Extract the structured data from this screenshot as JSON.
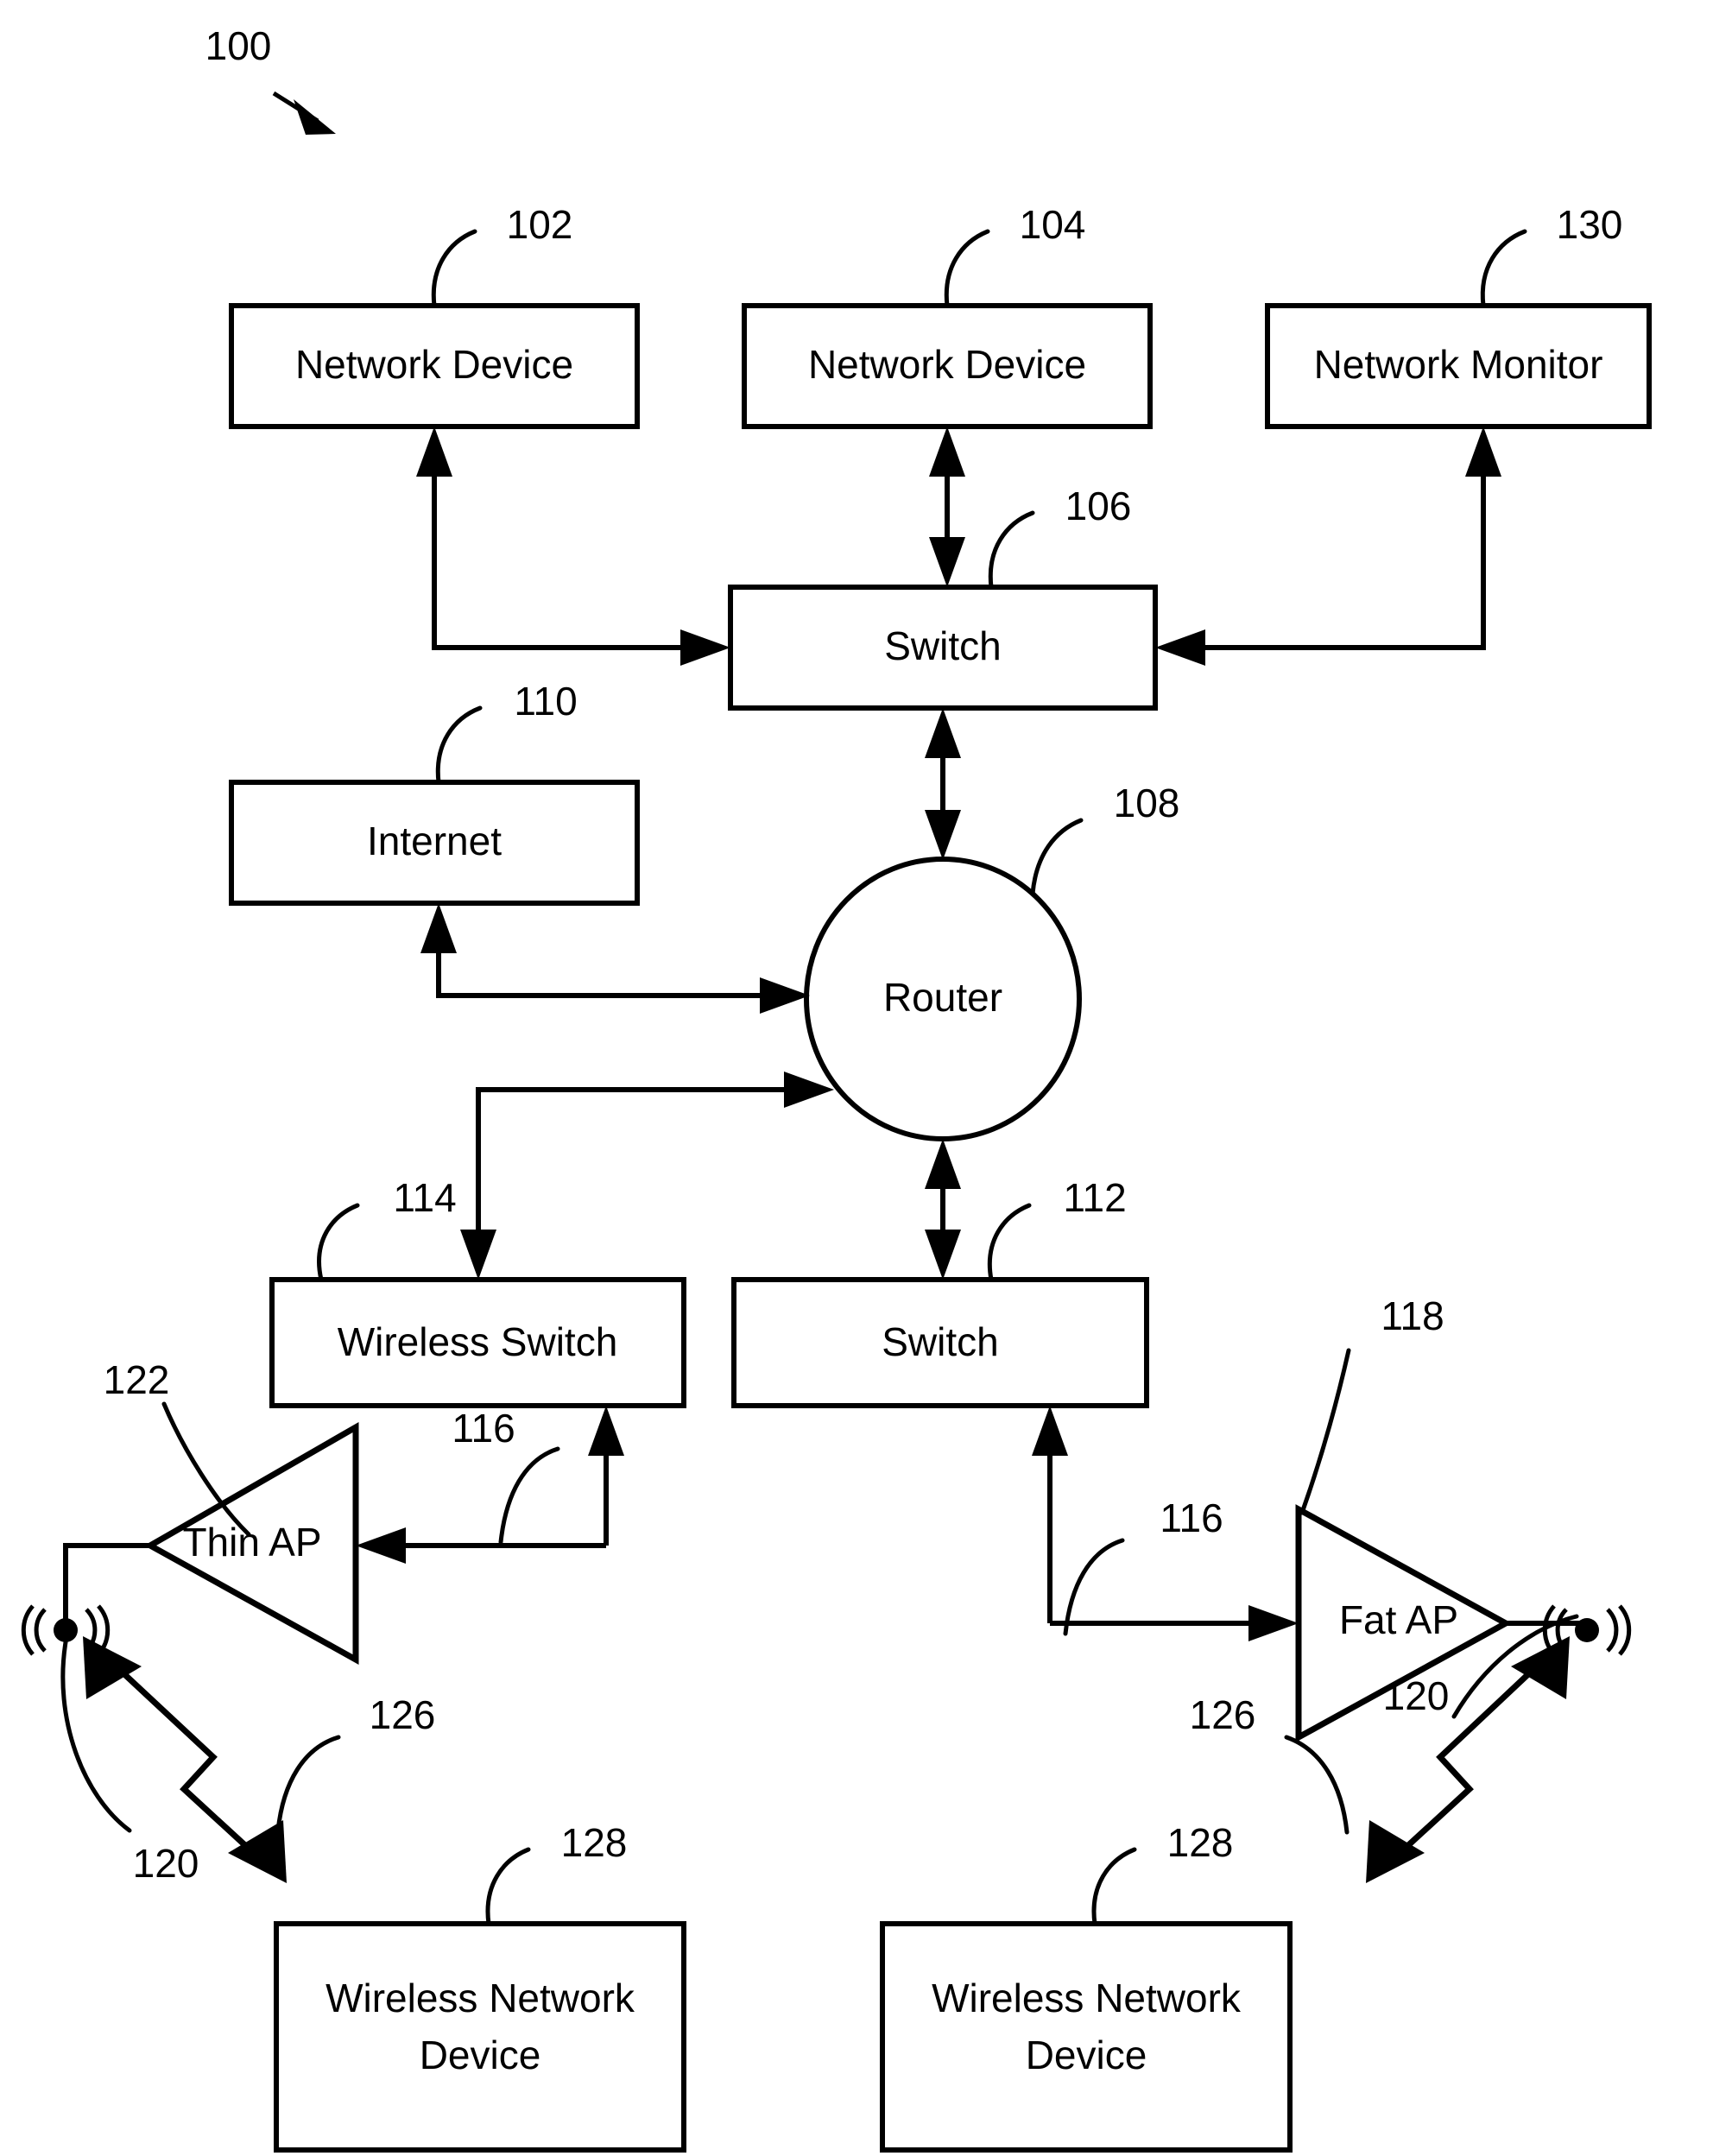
{
  "figure": {
    "reference_number": "100",
    "nodes": {
      "network_device_102": {
        "label": "Network Device",
        "ref": "102"
      },
      "network_device_104": {
        "label": "Network Device",
        "ref": "104"
      },
      "network_monitor_130": {
        "label": "Network Monitor",
        "ref": "130"
      },
      "switch_106": {
        "label": "Switch",
        "ref": "106"
      },
      "internet_110": {
        "label": "Internet",
        "ref": "110"
      },
      "router_108": {
        "label": "Router",
        "ref": "108"
      },
      "wireless_switch_114": {
        "label": "Wireless Switch",
        "ref": "114"
      },
      "switch_112": {
        "label": "Switch",
        "ref": "112"
      },
      "thin_ap_122": {
        "label": "Thin AP",
        "ref": "122"
      },
      "fat_ap_118": {
        "label": "Fat AP",
        "ref": "118"
      },
      "wireless_network_device_left": {
        "label_line1": "Wireless Network",
        "label_line2": "Device",
        "ref": "128"
      },
      "wireless_network_device_right": {
        "label_line1": "Wireless Network",
        "label_line2": "Device",
        "ref": "128"
      }
    },
    "link_refs": {
      "wired_link_left_116": "116",
      "wired_link_right_116": "116",
      "antenna_left_120": "120",
      "antenna_right_120": "120",
      "wireless_link_left_126": "126",
      "wireless_link_right_126": "126"
    }
  }
}
